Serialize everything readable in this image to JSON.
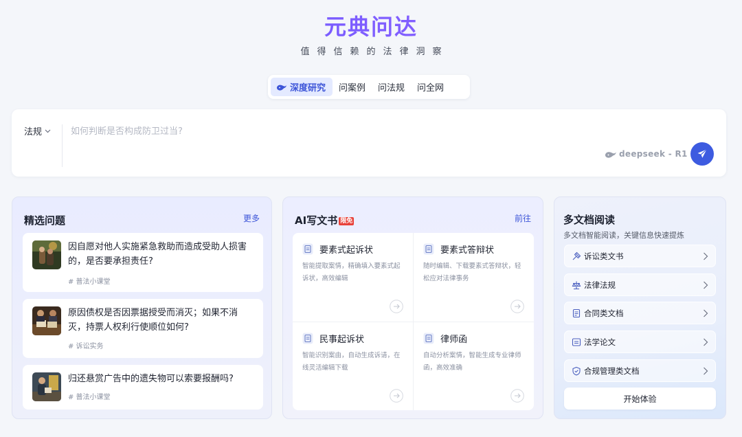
{
  "brand": {
    "logo": "元典问达",
    "slogan": "值得信赖的法律洞察"
  },
  "tabs": [
    {
      "label": "深度研究",
      "active": true
    },
    {
      "label": "问案例"
    },
    {
      "label": "问法规"
    },
    {
      "label": "问全网"
    }
  ],
  "search": {
    "scope": "法规",
    "placeholder": "如何判断是否构成防卫过当?",
    "model": "deepseek - R1"
  },
  "featured": {
    "title": "精选问题",
    "more": "更多",
    "items": [
      {
        "text": "因自愿对他人实施紧急救助而造成受助人损害的，是否要承担责任?",
        "tag": "# 普法小课堂"
      },
      {
        "text": "原因债权是否因票据授受而消灭；如果不消灭，持票人权利行使顺位如何?",
        "tag": "# 诉讼实务"
      },
      {
        "text": "归还悬赏广告中的遗失物可以索要报酬吗?",
        "tag": "# 普法小课堂"
      }
    ]
  },
  "ai_docs": {
    "title": "AI写文书",
    "badge": "限免",
    "more": "前往",
    "items": [
      {
        "title": "要素式起诉状",
        "desc": "智能提取案情，精确填入要素式起诉状，高效编辑"
      },
      {
        "title": "要素式答辩状",
        "desc": "随时编辑、下载要素式答辩状，轻松应对法律事务"
      },
      {
        "title": "民事起诉状",
        "desc": "智能识别案由，自动生成诉请，在线灵活编辑下载"
      },
      {
        "title": "律师函",
        "desc": "自动分析案情，智能生成专业律师函，高效准确"
      }
    ]
  },
  "multi_doc": {
    "title": "多文档阅读",
    "subtitle": "多文档智能阅读，关键信息快速提炼",
    "items": [
      {
        "label": "诉讼类文书",
        "icon": "hammer-icon"
      },
      {
        "label": "法律法规",
        "icon": "scale-icon"
      },
      {
        "label": "合同类文档",
        "icon": "contract-icon"
      },
      {
        "label": "法学论文",
        "icon": "paper-icon"
      },
      {
        "label": "合规管理类文档",
        "icon": "shield-icon"
      }
    ],
    "start": "开始体验"
  },
  "colors": {
    "accent": "#3d5be0",
    "badge": "#e8423a",
    "logo_from": "#5b8cff",
    "logo_to": "#9d6bff"
  }
}
